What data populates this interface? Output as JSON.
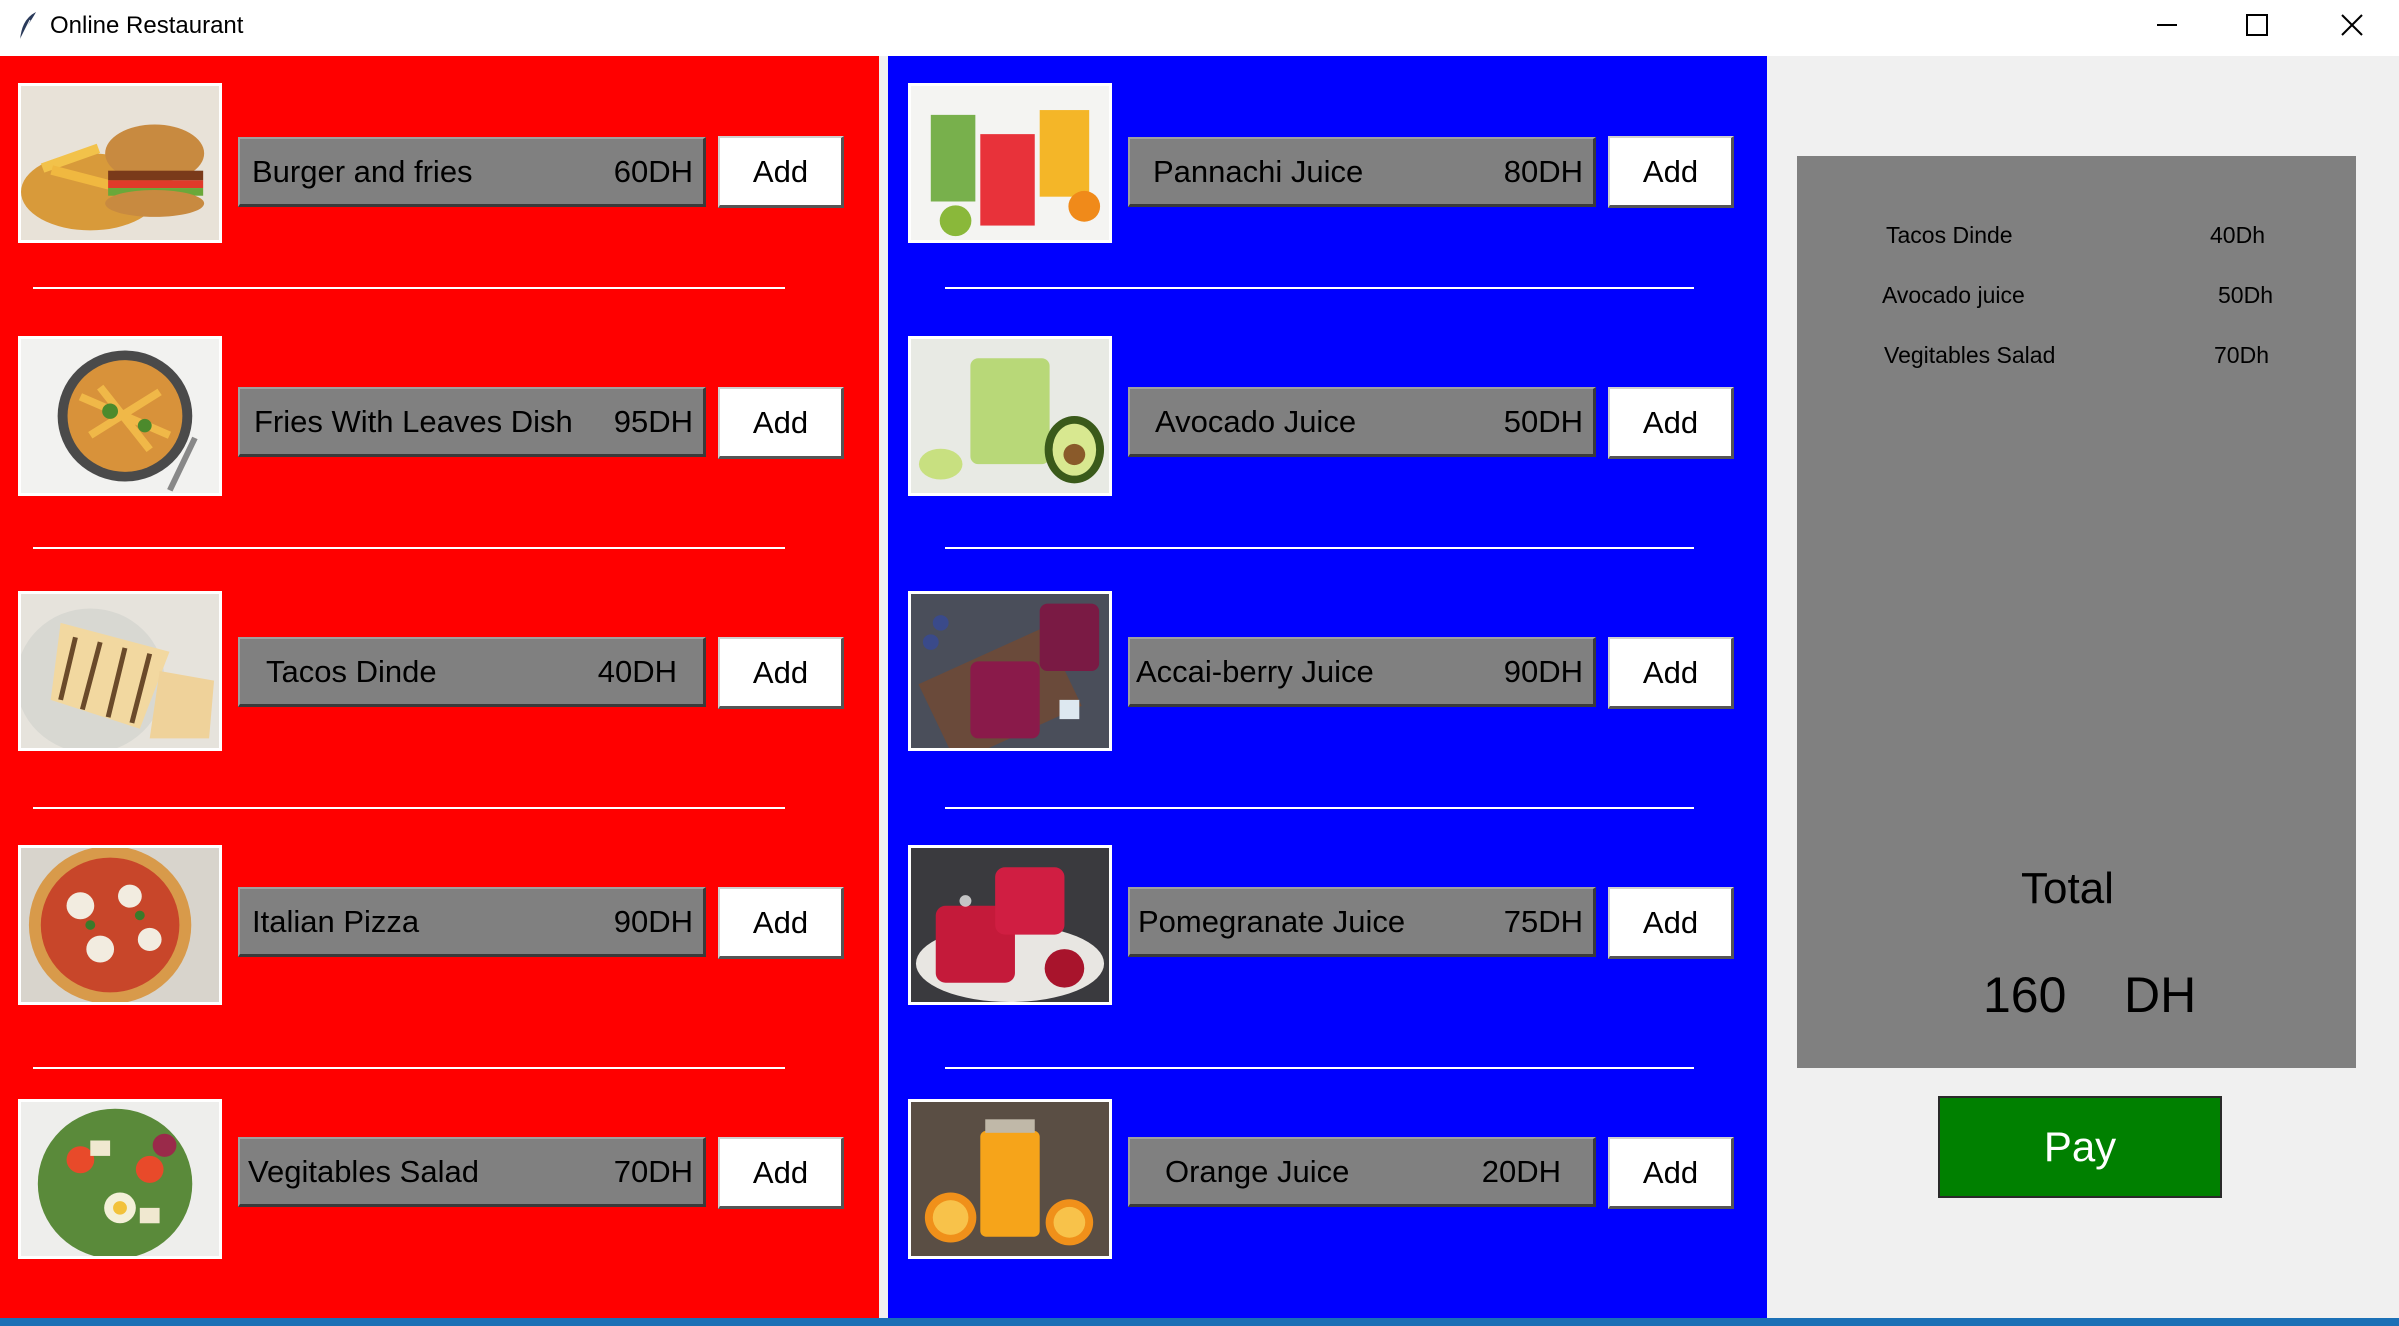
{
  "window": {
    "title": "Online Restaurant"
  },
  "food_items": [
    {
      "name": "Burger and fries",
      "price": "60DH",
      "add_label": "Add"
    },
    {
      "name": "Fries With Leaves Dish",
      "price": "95DH",
      "add_label": "Add"
    },
    {
      "name": "Tacos Dinde",
      "price": "40DH",
      "add_label": "Add"
    },
    {
      "name": "Italian Pizza",
      "price": "90DH",
      "add_label": "Add"
    },
    {
      "name": "Vegitables Salad",
      "price": "70DH",
      "add_label": "Add"
    }
  ],
  "drink_items": [
    {
      "name": "Pannachi Juice",
      "price": "80DH",
      "add_label": "Add"
    },
    {
      "name": "Avocado Juice",
      "price": "50DH",
      "add_label": "Add"
    },
    {
      "name": "Accai-berry Juice",
      "price": "90DH",
      "add_label": "Add"
    },
    {
      "name": "Pomegranate Juice",
      "price": "75DH",
      "add_label": "Add"
    },
    {
      "name": "Orange Juice",
      "price": "20DH",
      "add_label": "Add"
    }
  ],
  "order": {
    "items": [
      {
        "name": "Tacos Dinde",
        "price": "40Dh"
      },
      {
        "name": "Avocado juice",
        "price": "50Dh"
      },
      {
        "name": "Vegitables Salad",
        "price": "70Dh"
      }
    ],
    "total_label": "Total",
    "total_amount": "160",
    "currency": "DH"
  },
  "pay_label": "Pay",
  "colors": {
    "food_panel": "#ff0000",
    "drinks_panel": "#0000ff",
    "item_label_bg": "#808080",
    "pay_button": "#008000",
    "order_box": "#808080"
  },
  "icons": [
    "feather-icon",
    "minimize-icon",
    "maximize-icon",
    "close-icon"
  ]
}
